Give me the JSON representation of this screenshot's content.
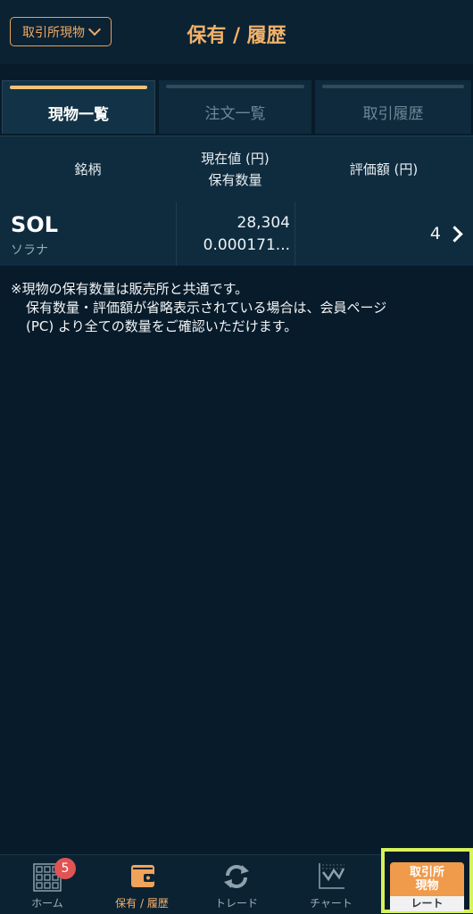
{
  "header": {
    "market_button": "取引所現物",
    "title": "保有 / 履歴"
  },
  "tabs": [
    {
      "label": "現物一覧",
      "active": true
    },
    {
      "label": "注文一覧",
      "active": false
    },
    {
      "label": "取引履歴",
      "active": false
    }
  ],
  "table": {
    "headers": {
      "symbol": "銘柄",
      "price_line1": "現在値 (円)",
      "price_line2": "保有数量",
      "value": "評価額 (円)"
    },
    "rows": [
      {
        "symbol": "SOL",
        "name": "ソラナ",
        "price": "28,304",
        "quantity": "0.000171...",
        "value": "4"
      }
    ]
  },
  "note": {
    "line1": "※現物の保有数量は販売所と共通です。",
    "line2": "保有数量・評価額が省略表示されている場合は、会員ページ",
    "line3": "(PC) より全ての数量をご確認いただけます。"
  },
  "bottom_nav": {
    "items": [
      {
        "label": "ホーム",
        "icon": "grid-icon",
        "badge": "5"
      },
      {
        "label": "保有 / 履歴",
        "icon": "wallet-icon",
        "active": true
      },
      {
        "label": "トレード",
        "icon": "refresh-icon"
      },
      {
        "label": "チャート",
        "icon": "chart-icon"
      }
    ],
    "rate_button": {
      "line1": "取引所",
      "line2": "現物",
      "line3": "レート"
    }
  },
  "colors": {
    "background": "#071b2a",
    "accent": "#f2b26a",
    "highlight": "#d7f25a",
    "badge": "#e05454"
  }
}
